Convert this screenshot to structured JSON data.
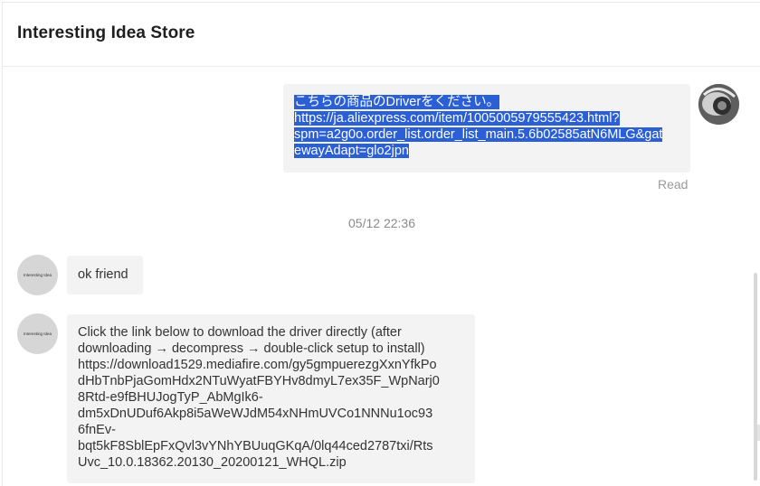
{
  "header": {
    "store_name": "Interesting Idea Store"
  },
  "messages": {
    "outgoing": {
      "lines": [
        "こちらの商品のDriverをください。",
        "https://ja.aliexpress.com/item/1005005979555423.html?",
        "spm=a2g0o.order_list.order_list_main.5.6b02585atN6MLG&gat",
        "ewayAdapt=glo2jpn"
      ],
      "status": "Read"
    },
    "timestamp": "05/12 22:36",
    "incoming": [
      {
        "avatar_text": "Interesting Idea",
        "lines": [
          "ok friend"
        ]
      },
      {
        "avatar_text": "Interesting Idea",
        "lines": [
          "Click the link below to download the driver directly (after",
          "downloading → decompress → double-click setup to install)",
          "https://download1529.mediafire.com/gy5gmpuerezgXxnYfkPo",
          "dHbTnbPjaGomHdx2NTuWyatFBYHv8dmyL7ex35F_WpNarj0",
          "8Rtd-e9fBHUJogTyP_AbMgIk6-",
          "dm5xDnUDuf6Akp8i5aWeWJdM54xNHmUVCo1NNNu1oc93",
          "6fnEv-",
          "bqt5kF8SblEpFxQvl3vYNhYBUuqGKqA/0lq44ced2787txi/Rts",
          "Uvc_10.0.18362.20130_20200121_WHQL.zip"
        ]
      }
    ]
  },
  "colors": {
    "selection": "#2a5fd6",
    "bubble": "#f3f3f3"
  }
}
